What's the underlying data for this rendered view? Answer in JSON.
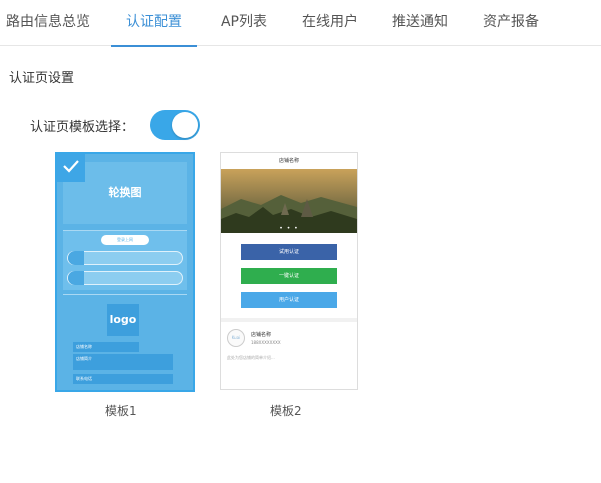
{
  "tabs": [
    {
      "label": "路由信息总览",
      "active": false
    },
    {
      "label": "认证配置",
      "active": true
    },
    {
      "label": "AP列表",
      "active": false
    },
    {
      "label": "在线用户",
      "active": false
    },
    {
      "label": "推送通知",
      "active": false
    },
    {
      "label": "资产报备",
      "active": false
    }
  ],
  "section_title": "认证页设置",
  "template_select_label": "认证页模板选择：",
  "toggle_on": true,
  "accent_color": "#3b8fd6",
  "template1": {
    "carousel_text": "轮换图",
    "connect_btn": "登录上网",
    "logo_text": "logo",
    "shop_name": "店铺名称",
    "shop_intro": "店铺简介",
    "contact_phone": "联系电话",
    "caption": "模板1",
    "selected": true
  },
  "template2": {
    "shop_title": "店铺名称",
    "btn_trial": "试用认证",
    "btn_onekey": "一键认证",
    "btn_user": "用户认证",
    "avatar_text": "Kuai",
    "shop_name": "店铺名称",
    "shop_phone": "188XXXXXXXX",
    "shop_desc": "此处为您店铺的简单介绍...",
    "caption": "模板2"
  }
}
